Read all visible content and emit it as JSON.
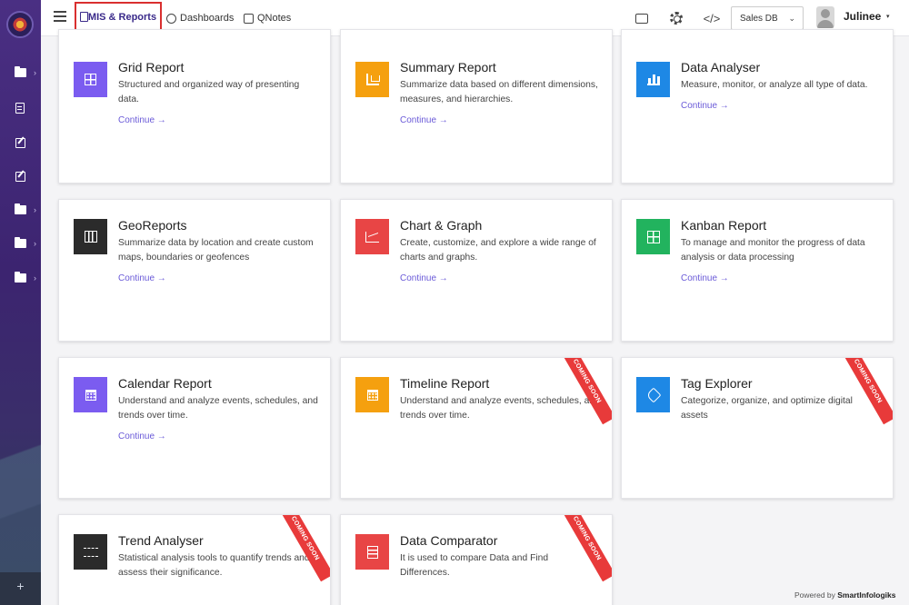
{
  "sidebar": {
    "items": [
      {
        "icon": "folder-icon",
        "chevron": "›"
      },
      {
        "icon": "document-icon",
        "chevron": ""
      },
      {
        "icon": "edit-icon",
        "chevron": ""
      },
      {
        "icon": "edit-icon",
        "chevron": ""
      },
      {
        "icon": "folder-icon",
        "chevron": "›"
      },
      {
        "icon": "folder-icon",
        "chevron": "›"
      },
      {
        "icon": "folder-icon",
        "chevron": "›"
      }
    ],
    "bottom_icon": "+"
  },
  "topbar": {
    "nav": [
      {
        "label": "MIS & Reports",
        "active": true
      },
      {
        "label": "Dashboards"
      },
      {
        "label": "QNotes"
      }
    ],
    "code_icon": "</>",
    "db_select": {
      "value": "Sales DB",
      "caret": "⌄"
    },
    "user": {
      "name": "Julinee",
      "caret": "▾"
    }
  },
  "cards": [
    {
      "title": "Grid Report",
      "desc": "Structured and organized way of presenting data.",
      "link": "Continue →",
      "color": "#7b5cf0",
      "icon": "grid-icon",
      "ribbon": ""
    },
    {
      "title": "Summary Report",
      "desc": "Summarize data based on different dimensions, measures, and hierarchies.",
      "link": "Continue →",
      "color": "#f5a00f",
      "icon": "summary-icon",
      "ribbon": ""
    },
    {
      "title": "Data Analyser",
      "desc": "Measure, monitor, or analyze all type of data.",
      "link": "Continue →",
      "color": "#1e88e5",
      "icon": "bar-chart-icon",
      "ribbon": ""
    },
    {
      "title": "GeoReports",
      "desc": "Summarize data by location and create custom maps, boundaries or geofences",
      "link": "Continue →",
      "color": "#2b2b2b",
      "icon": "map-icon",
      "ribbon": ""
    },
    {
      "title": "Chart & Graph",
      "desc": "Create, customize, and explore a wide range of charts and graphs.",
      "link": "Continue →",
      "color": "#e84545",
      "icon": "line-chart-icon",
      "ribbon": ""
    },
    {
      "title": "Kanban Report",
      "desc": "To manage and monitor the progress of data analysis or data processing",
      "link": "Continue →",
      "color": "#22b35e",
      "icon": "kanban-icon",
      "ribbon": ""
    },
    {
      "title": "Calendar Report",
      "desc": "Understand and analyze events, schedules, and trends over time.",
      "link": "Continue →",
      "color": "#7b5cf0",
      "icon": "calendar-icon",
      "ribbon": ""
    },
    {
      "title": "Timeline Report",
      "desc": "Understand and analyze events, schedules, and trends over time.",
      "link": "",
      "color": "#f5a00f",
      "icon": "timeline-icon",
      "ribbon": "COMING SOON"
    },
    {
      "title": "Tag Explorer",
      "desc": "Categorize, organize, and optimize digital assets",
      "link": "",
      "color": "#1e88e5",
      "icon": "tag-icon",
      "ribbon": "COMING SOON"
    },
    {
      "title": "Trend Analyser",
      "desc": "Statistical analysis tools to quantify trends and assess their significance.",
      "link": "",
      "color": "#2b2b2b",
      "icon": "trend-icon",
      "ribbon": "COMING SOON"
    },
    {
      "title": "Data Comparator",
      "desc": "It is used to compare Data and Find Differences.",
      "link": "",
      "color": "#e84545",
      "icon": "compare-icon",
      "ribbon": "COMING SOON"
    }
  ],
  "footer": {
    "prefix": "Powered by",
    "brand": "SmartInfologiks"
  }
}
